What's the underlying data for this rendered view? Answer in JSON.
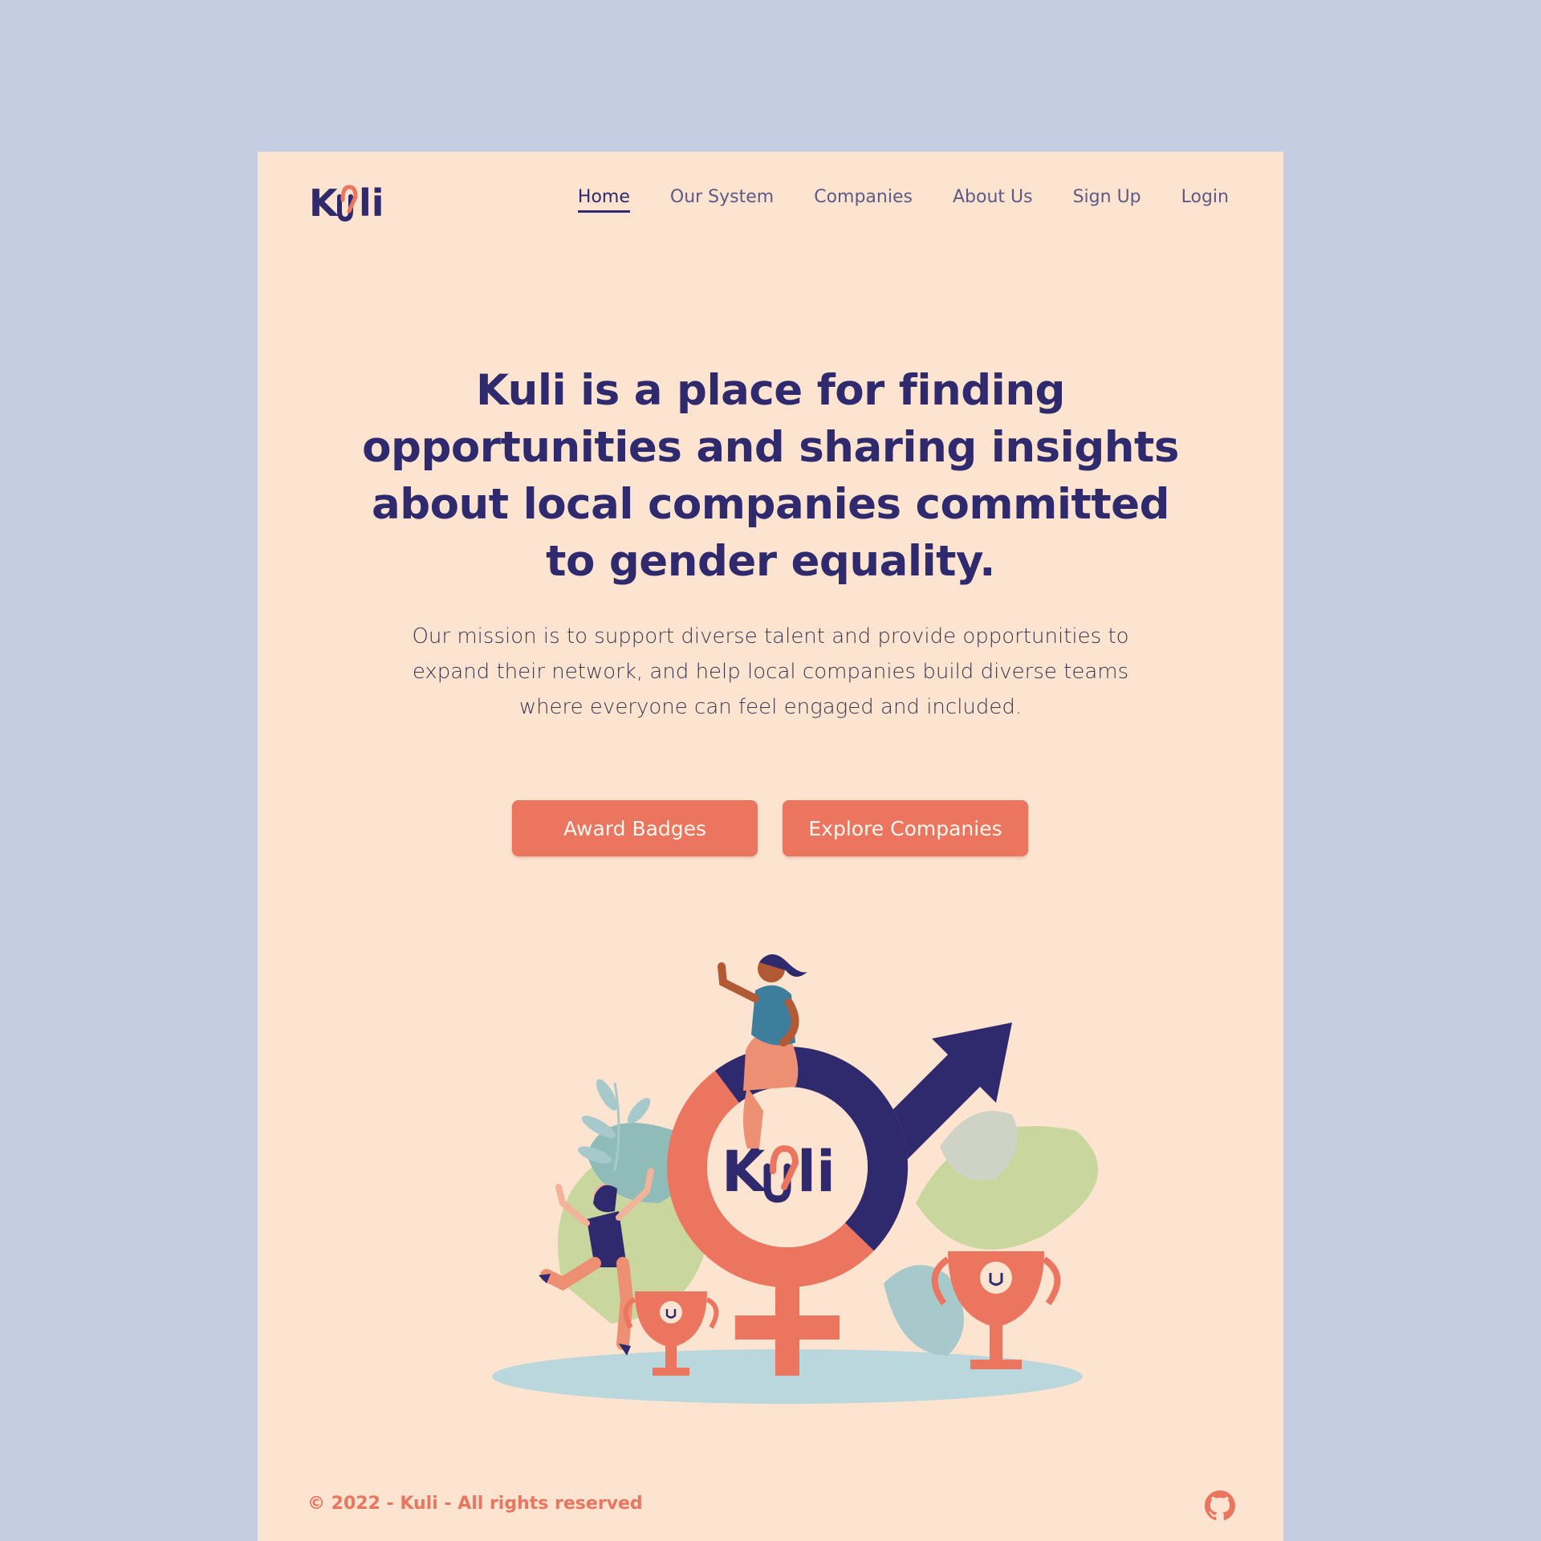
{
  "brand": {
    "name": "Kuli",
    "primary_color": "#2f296e",
    "accent_color": "#ec7560",
    "page_background": "#fde4d1",
    "outer_background": "#c5cde3"
  },
  "nav": {
    "items": [
      {
        "label": "Home",
        "active": true
      },
      {
        "label": "Our System"
      },
      {
        "label": "Companies"
      },
      {
        "label": "About Us"
      },
      {
        "label": "Sign Up"
      },
      {
        "label": "Login"
      }
    ]
  },
  "hero": {
    "headline_lines": [
      "Kuli is a place for finding",
      "opportunities and sharing insights",
      "about local companies committed",
      "to gender equality."
    ],
    "mission_lines": [
      "Our mission is to support diverse talent and provide opportunities to",
      "expand their network, and help local companies build diverse teams",
      "where everyone can feel engaged and included."
    ],
    "buttons": {
      "award_badges": "Award Badges",
      "explore_companies": "Explore Companies"
    }
  },
  "illustration": {
    "icon": "gender-equality-illustration"
  },
  "footer": {
    "copyright": "© 2022 - Kuli - All rights reserved",
    "github_icon": "github-icon"
  }
}
